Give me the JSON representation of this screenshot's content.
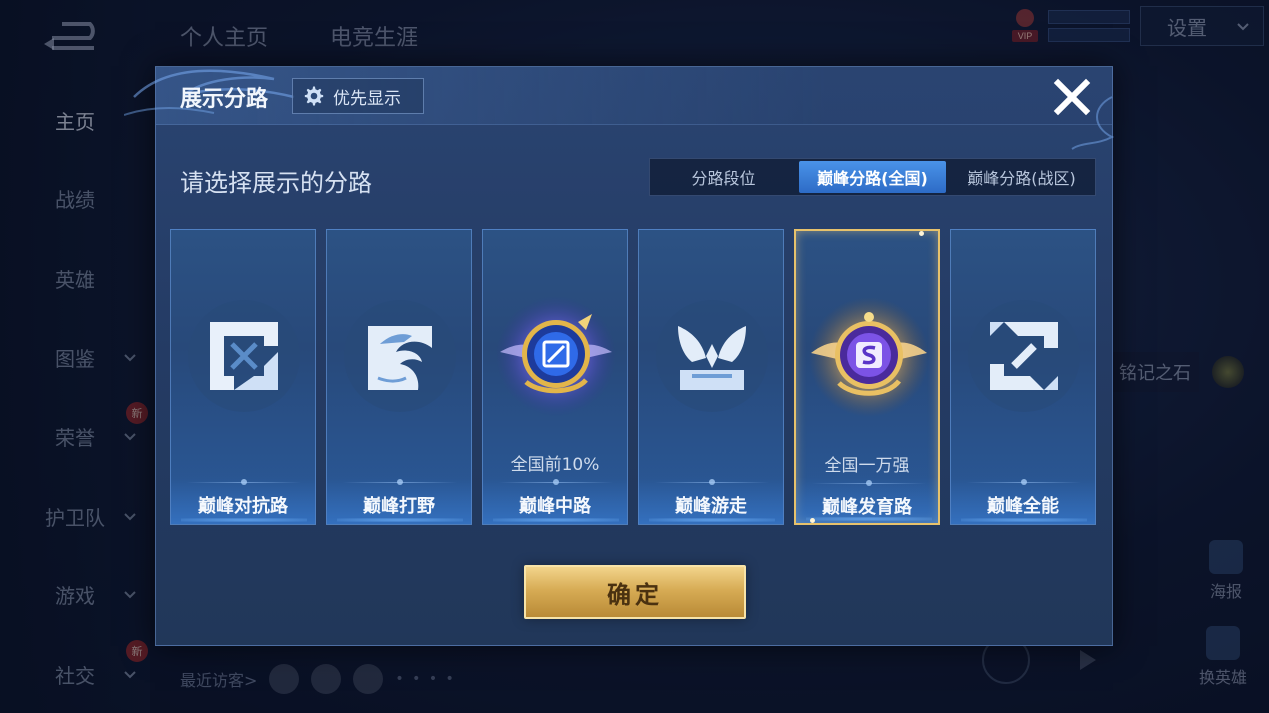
{
  "background": {
    "sidebar": {
      "items": [
        {
          "label": "主页",
          "active": true,
          "chevron": false,
          "new": false
        },
        {
          "label": "战绩",
          "active": false,
          "chevron": false,
          "new": false
        },
        {
          "label": "英雄",
          "active": false,
          "chevron": false,
          "new": false
        },
        {
          "label": "图鉴",
          "active": false,
          "chevron": true,
          "new": false
        },
        {
          "label": "荣誉",
          "active": false,
          "chevron": true,
          "new": true
        },
        {
          "label": "护卫队",
          "active": false,
          "chevron": true,
          "new": false
        },
        {
          "label": "游戏",
          "active": false,
          "chevron": true,
          "new": false
        },
        {
          "label": "社交",
          "active": false,
          "chevron": true,
          "new": true
        }
      ],
      "new_badge": "新"
    },
    "top_tabs": [
      "个人主页",
      "电竞生涯"
    ],
    "settings_label": "设置",
    "vip_label": "VIP",
    "visitors_label": "最近访客>",
    "visitors_more": "• • • •",
    "stone_label": "铭记之石",
    "poster_label": "海报",
    "change_hero_label": "换英雄"
  },
  "modal": {
    "title": "展示分路",
    "priority_label": "优先显示",
    "subtitle": "请选择展示的分路",
    "tabs": [
      {
        "label": "分路段位",
        "active": false
      },
      {
        "label": "巅峰分路(全国)",
        "active": true
      },
      {
        "label": "巅峰分路(战区)",
        "active": false
      }
    ],
    "cards": [
      {
        "name": "巅峰对抗路",
        "rank": "",
        "icon": "sword-lane-icon",
        "selected": false
      },
      {
        "name": "巅峰打野",
        "rank": "",
        "icon": "dragon-jungle-icon",
        "selected": false
      },
      {
        "name": "巅峰中路",
        "rank": "全国前10%",
        "icon": "mid-lane-emblem-icon",
        "selected": false
      },
      {
        "name": "巅峰游走",
        "rank": "",
        "icon": "wings-roam-icon",
        "selected": false
      },
      {
        "name": "巅峰发育路",
        "rank": "全国一万强",
        "icon": "marksman-lane-emblem-icon",
        "selected": true
      },
      {
        "name": "巅峰全能",
        "rank": "",
        "icon": "allround-icon",
        "selected": false
      }
    ],
    "confirm_label": "确定",
    "colors": {
      "accent_blue": "#3b82d9",
      "gold": "#d7ac55",
      "selected_border": "#e7c26c"
    }
  }
}
